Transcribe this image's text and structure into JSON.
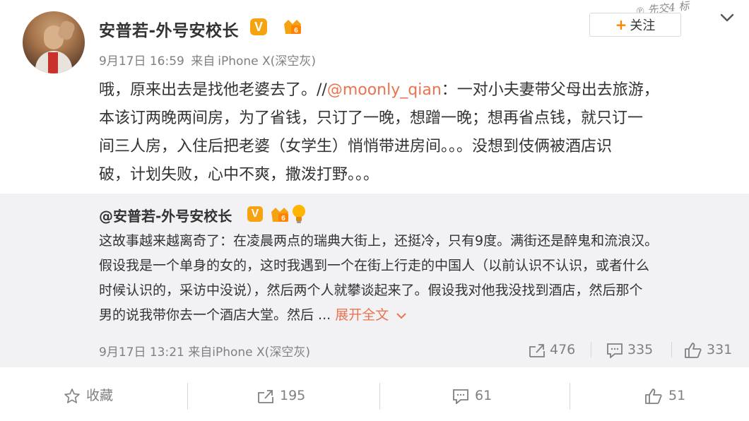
{
  "post": {
    "author_name": "安普若-外号安校长",
    "verified_badge": "V",
    "timestamp": "9月17日 16:59",
    "source_prefix": "来自",
    "source_device": "iPhone X(深空灰)",
    "follow_label": "关注",
    "follow_plus": "+",
    "text_before_mention": "哦，原来出去是找他老婆去了。//",
    "mention": "@moonly_qian",
    "text_line1_after": "：一对小夫妻带父母出去旅游，",
    "text_line2": "本该订两晚两间房，为了省钱，只订了一晚，想蹭一晚；想再省点钱，就只订一",
    "text_line3": "间三人房，入住后把老婆（女学生）悄悄带进房间。。。没想到伎俩被酒店识",
    "text_line4": "破，计划失败，心中不爽，撒泼打野。。。"
  },
  "retweet": {
    "author_name": "@安普若-外号安校长",
    "verified_badge": "V",
    "line1": "这故事越来越离奇了：在凌晨两点的瑞典大街上，还挺冷，只有9度。满街还是醉鬼和流浪汉。",
    "line2": "假设我是一个单身的女的，这时我遇到一个在街上行走的中国人（以前认识不认识，或者什么",
    "line3": "时候认识的，采访中没说），然后两个人就攀谈起来了。假设我对他我没找到酒店，然后那个",
    "line4_prefix": "男的说我带你去一个酒店大堂。然后 ...",
    "expand_label": "展开全文",
    "timestamp": "9月17日 13:21",
    "source_prefix": "来自",
    "source_device": "iPhone X(深空灰)",
    "reposts": "476",
    "comments": "335",
    "likes": "331"
  },
  "actions": {
    "favorite_label": "收藏",
    "repost_count": "195",
    "comment_count": "61",
    "like_count": "51"
  },
  "colors": {
    "accent_orange": "#ff8200",
    "link": "#eb7350",
    "badge": "#f6a312",
    "muted_text": "#808080",
    "retweet_bg": "#f2f2f5"
  },
  "icons": [
    "star-icon",
    "repost-icon",
    "comment-icon",
    "like-icon",
    "chevron-down-icon",
    "level-badge-icon",
    "lightbulb-icon"
  ]
}
